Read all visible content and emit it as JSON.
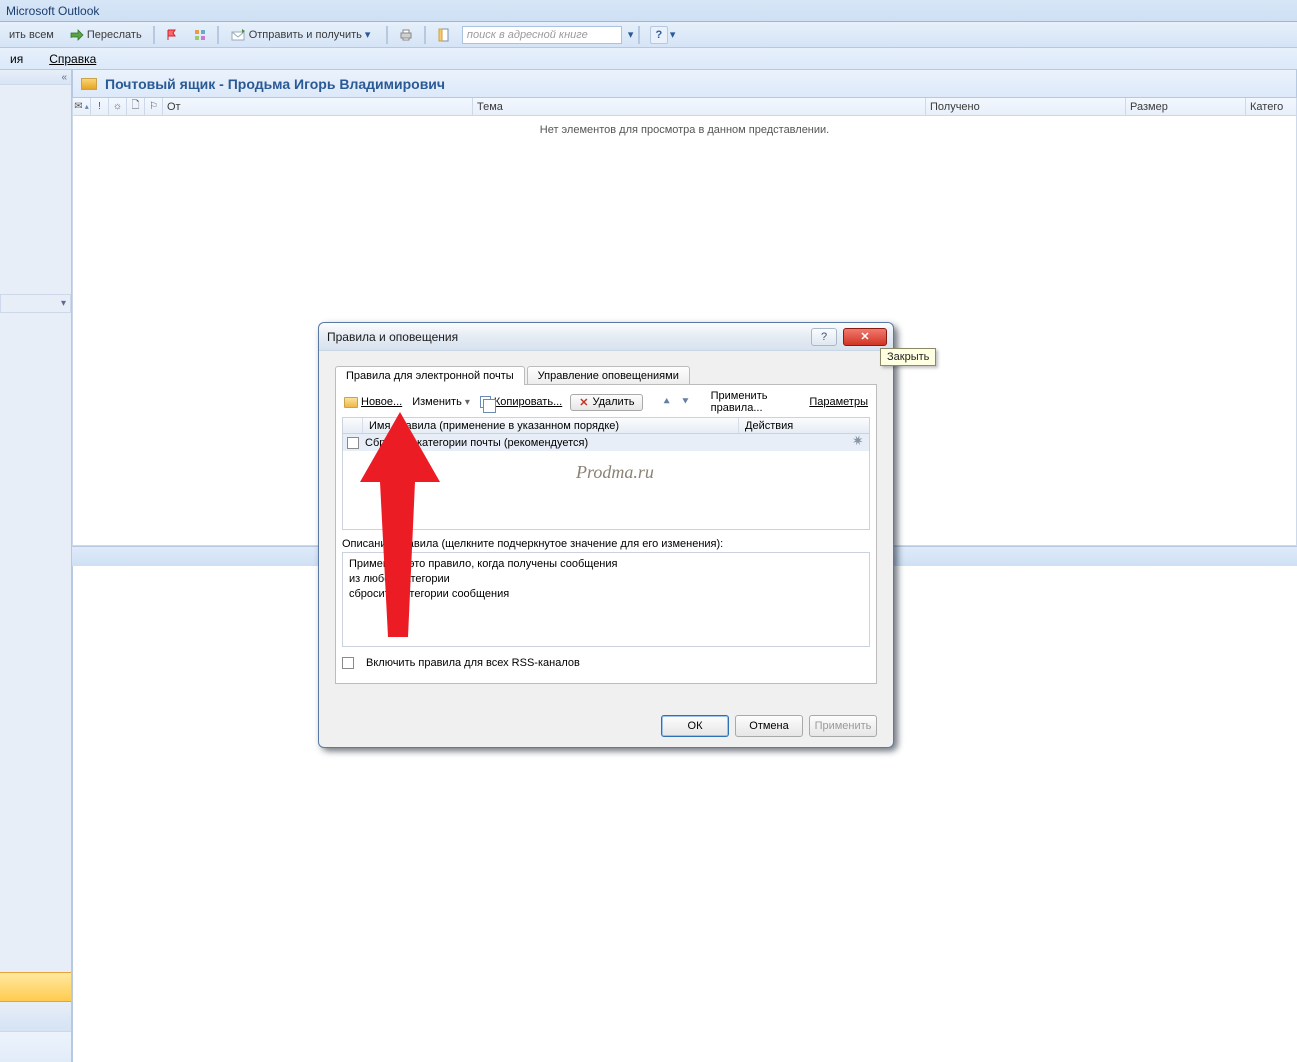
{
  "app": {
    "title": "Microsoft Outlook"
  },
  "toolbar": {
    "reply_all": "ить всем",
    "forward": "Переслать",
    "send_receive": "Отправить и получить",
    "search_placeholder": "поиск в адресной книге"
  },
  "menu": {
    "actions": "ия",
    "help": "Справка"
  },
  "mail": {
    "header_title": "Почтовый ящик - Продьма Игорь Владимирович",
    "columns": {
      "from": "От",
      "subject": "Тема",
      "received": "Получено",
      "size": "Размер",
      "category": "Катего"
    },
    "empty_text": "Нет элементов для просмотра в данном представлении."
  },
  "dialog": {
    "title": "Правила и оповещения",
    "tooltip_close": "Закрыть",
    "tabs": {
      "rules": "Правила для электронной почты",
      "alerts": "Управление оповещениями"
    },
    "tbar": {
      "new": "Новое...",
      "edit": "Изменить",
      "copy": "Копировать...",
      "delete": "Удалить",
      "apply": "Применить правила...",
      "options": "Параметры"
    },
    "grid": {
      "col_name": "Имя правила (применение в указанном порядке)",
      "col_actions": "Действия",
      "row1": "Сбросить категории почты (рекомендуется)"
    },
    "watermark": "Prodma.ru",
    "desc_label": "Описание правила (щелкните подчеркнутое значение для его изменения):",
    "desc_lines": {
      "l1": "Применить это правило, когда получены сообщения",
      "l2": "из любой категории",
      "l3": "сбросить категории сообщения"
    },
    "rss_label": "Включить правила для всех RSS-каналов",
    "buttons": {
      "ok": "ОК",
      "cancel": "Отмена",
      "apply": "Применить"
    }
  }
}
